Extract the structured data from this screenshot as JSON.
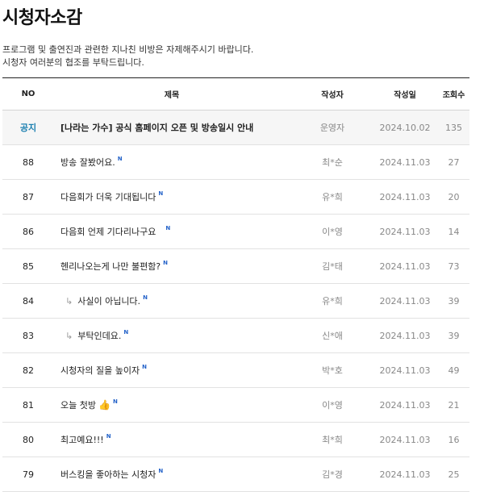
{
  "page": {
    "title": "시청자소감",
    "desc_line1": "프로그램 및 출연진과 관련한 지나친 비방은 자제해주시기 바랍니다.",
    "desc_line2": "시청자 여러분의 협조를 부탁드립니다."
  },
  "table": {
    "headers": {
      "no": "NO",
      "title": "제목",
      "author": "작성자",
      "date": "작성일",
      "views": "조회수"
    },
    "new_badge": "N",
    "reply_arrow": "↳",
    "notice": {
      "label": "공지",
      "title": "[나라는 가수] 공식 홈페이지 오픈 및 방송일시 안내",
      "author": "운영자",
      "date": "2024.10.02",
      "views": "135"
    },
    "rows": [
      {
        "no": "88",
        "title": "방송 잘봤어요.",
        "author": "최*순",
        "date": "2024.11.03",
        "views": "27"
      },
      {
        "no": "87",
        "title": "다음회가 더욱 기대됩니다",
        "author": "유*희",
        "date": "2024.11.03",
        "views": "20"
      },
      {
        "no": "86",
        "title": "다음회 언제 기다리나구요",
        "author": "이*영",
        "date": "2024.11.03",
        "views": "14"
      },
      {
        "no": "85",
        "title": "헨리나오는게 나만 불편함?",
        "author": "김*태",
        "date": "2024.11.03",
        "views": "73"
      },
      {
        "no": "84",
        "title": "사실이 아닙니다.",
        "author": "유*희",
        "date": "2024.11.03",
        "views": "39"
      },
      {
        "no": "83",
        "title": "부탁인데요.",
        "author": "신*애",
        "date": "2024.11.03",
        "views": "39"
      },
      {
        "no": "82",
        "title": "시청자의 질을 높이자",
        "author": "박*호",
        "date": "2024.11.03",
        "views": "49"
      },
      {
        "no": "81",
        "title": "오늘 첫방",
        "author": "이*영",
        "date": "2024.11.03",
        "views": "21"
      },
      {
        "no": "80",
        "title": "최고예요!!!",
        "author": "최*희",
        "date": "2024.11.03",
        "views": "16"
      },
      {
        "no": "79",
        "title": "버스킹을 좋아하는 시청자",
        "author": "김*경",
        "date": "2024.11.03",
        "views": "25"
      }
    ]
  },
  "icons": {
    "thumbs_up": "👍"
  },
  "colors": {
    "notice_label": "#1a7fb0",
    "new_badge": "#2563c9",
    "notice_bg": "#f6f6f6"
  }
}
